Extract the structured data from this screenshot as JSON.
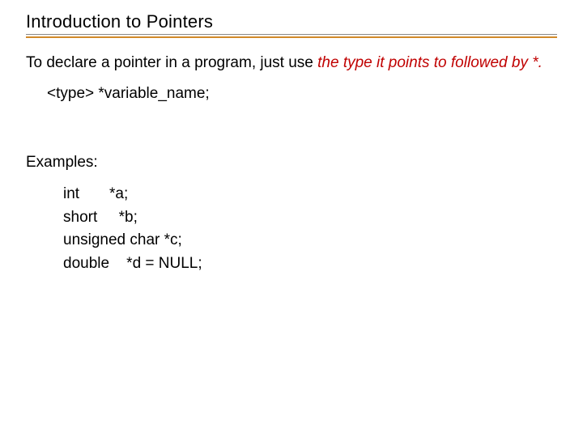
{
  "title": "Introduction to Pointers",
  "intro": {
    "lead": "To declare a pointer in a program, just use ",
    "emph": "the type it points to followed by *."
  },
  "syntax": "<type>  *variable_name;",
  "examples_label": "Examples:",
  "examples": [
    {
      "text": "int       *a;"
    },
    {
      "text": "short     *b;"
    },
    {
      "text": "unsigned char *c;"
    },
    {
      "text": "double    *d = NULL;"
    }
  ]
}
